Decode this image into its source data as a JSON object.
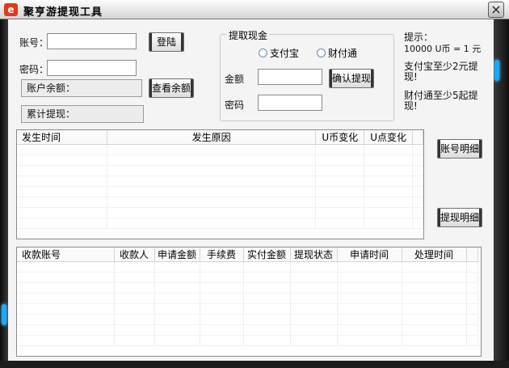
{
  "window": {
    "title": "聚亨游提现工具",
    "close": "×",
    "icon_letter": "e"
  },
  "login": {
    "account_label": "账号：",
    "account_value": "",
    "password_label": "密码：",
    "password_value": "",
    "login_button": "登陆",
    "balance_label": "账户余额：",
    "total_label": "累计提现：",
    "check_balance_button": "查看余额"
  },
  "withdraw": {
    "group_title": "提取现金",
    "option_alipay": "支付宝",
    "option_tenpay": "财付通",
    "amount_label": "金额",
    "amount_value": "",
    "password_label": "密码",
    "password_value": "",
    "confirm_button": "确认提现"
  },
  "tips": {
    "heading": "提示：",
    "rate": "10000 U币 = 1 元",
    "alipay_min": "支付宝至少2元提现!",
    "tenpay_min": "财付通至少5起提现!"
  },
  "account_log": {
    "columns": [
      "发生时间",
      "发生原因",
      "U币变化",
      "U点变化"
    ]
  },
  "withdraw_log": {
    "columns": [
      "收款账号",
      "收款人",
      "申请金额",
      "手续费",
      "实付金额",
      "提现状态",
      "申请时间",
      "处理时间"
    ]
  },
  "side_buttons": {
    "account_detail": "账号明细",
    "withdraw_detail": "提现明细"
  },
  "colors": {
    "accent_glow": "#19a9ff",
    "frame": "#1a1a1a",
    "window_bg": "#f4f4f4"
  }
}
